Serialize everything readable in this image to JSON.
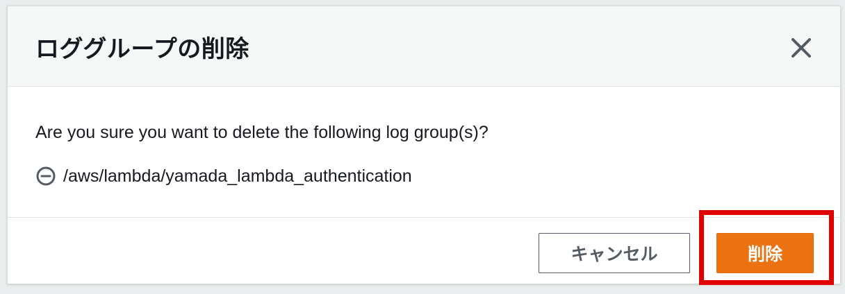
{
  "dialog": {
    "title": "ロググループの削除",
    "close_icon": "close-icon"
  },
  "body": {
    "question": "Are you sure you want to delete the following log group(s)?",
    "log_groups": [
      {
        "icon": "minus-circle-icon",
        "name": "/aws/lambda/yamada_lambda_authentication"
      }
    ]
  },
  "footer": {
    "cancel_label": "キャンセル",
    "delete_label": "削除"
  },
  "colors": {
    "primary_button": "#ec7211",
    "highlight": "#e00000"
  }
}
